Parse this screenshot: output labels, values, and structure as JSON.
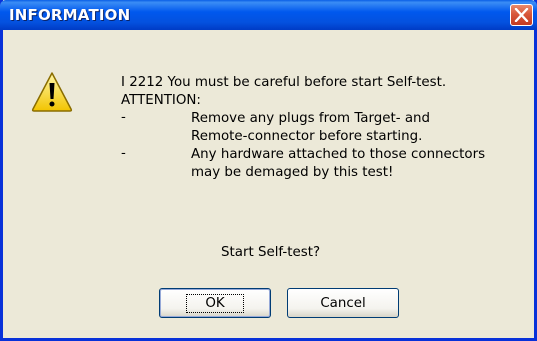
{
  "window": {
    "title": "INFORMATION"
  },
  "message": {
    "line1": "I 2212 You must be careful before start Self-test.",
    "line2": "ATTENTION:",
    "bullets": [
      {
        "dash": "-",
        "lines": [
          "Remove any plugs from Target- and",
          "Remote-connector before starting."
        ]
      },
      {
        "dash": "-",
        "lines": [
          "Any hardware attached to those connectors",
          "may be demaged by this test!"
        ]
      }
    ]
  },
  "prompt": "Start Self-test?",
  "buttons": {
    "ok_label": "OK",
    "cancel_label": "Cancel"
  },
  "icons": {
    "warning": "warning-icon",
    "close": "close-icon"
  },
  "colors": {
    "titlebar": "#0058ee",
    "close_button": "#d8573a",
    "dialog_background": "#ece9d8"
  }
}
